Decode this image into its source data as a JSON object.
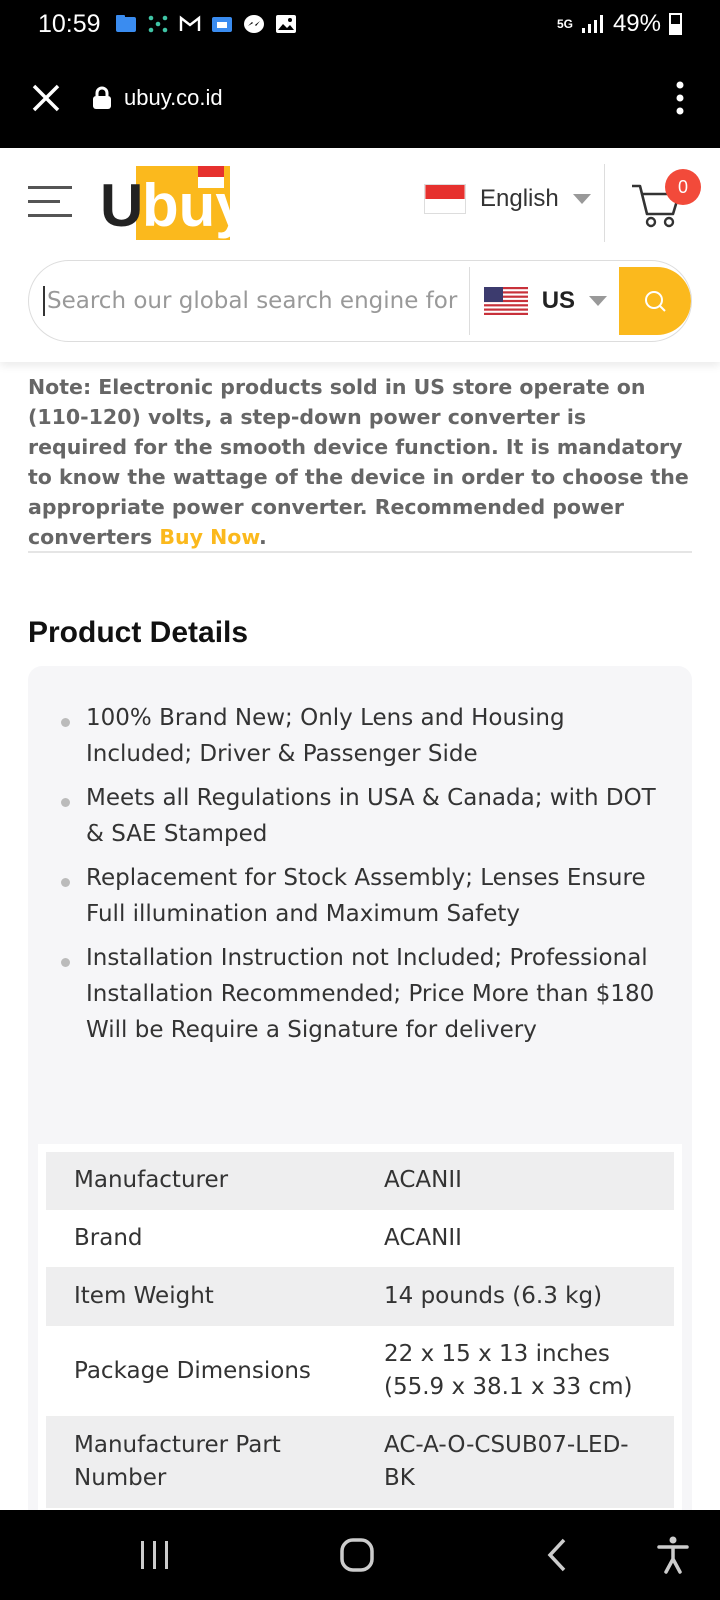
{
  "status_bar": {
    "time": "10:59",
    "network": "5G",
    "battery": "49%",
    "icons": [
      "files-icon",
      "network-dots-icon",
      "gmail-icon",
      "folder-icon",
      "messenger-icon",
      "gallery-icon"
    ]
  },
  "browser": {
    "url": "ubuy.co.id",
    "close_icon": "close-icon",
    "menu_icon": "more-vert-icon"
  },
  "header": {
    "logo_text": "Ubuy",
    "language": "English",
    "cart_count": "0",
    "search": {
      "placeholder": "Search our global search engine for",
      "store": "US"
    }
  },
  "note": {
    "text": "Note: Electronic products sold in US store operate on (110-120) volts, a step-down power converter is required for the smooth device function. It is mandatory to know the wattage of the device in order to choose the appropriate power converter. Recommended power converters ",
    "link": "Buy Now",
    "end": "."
  },
  "product_details": {
    "title": "Product Details",
    "bullets": [
      "100% Brand New; Only Lens and Housing Included; Driver & Passenger Side",
      "Meets all Regulations in USA & Canada; with DOT & SAE Stamped",
      "Replacement for Stock Assembly; Lenses Ensure Full illumination and Maximum Safety",
      "Installation Instruction not Included; Professional Installation Recommended; Price More than $180 Will be Require a Signature for delivery"
    ],
    "specs": [
      {
        "key": "Manufacturer",
        "value": "ACANII"
      },
      {
        "key": "Brand",
        "value": "ACANII"
      },
      {
        "key": "Item Weight",
        "value": "14 pounds (6.3 kg)"
      },
      {
        "key": "Package Dimensions",
        "value": "22 x 15 x 13 inches (55.9 x 38.1 x 33 cm)"
      },
      {
        "key": "Manufacturer Part Number",
        "value": "AC-A-O-CSUB07-LED-BK"
      }
    ]
  },
  "colors": {
    "accent": "#fbb91d",
    "badge": "#f24a3a"
  }
}
